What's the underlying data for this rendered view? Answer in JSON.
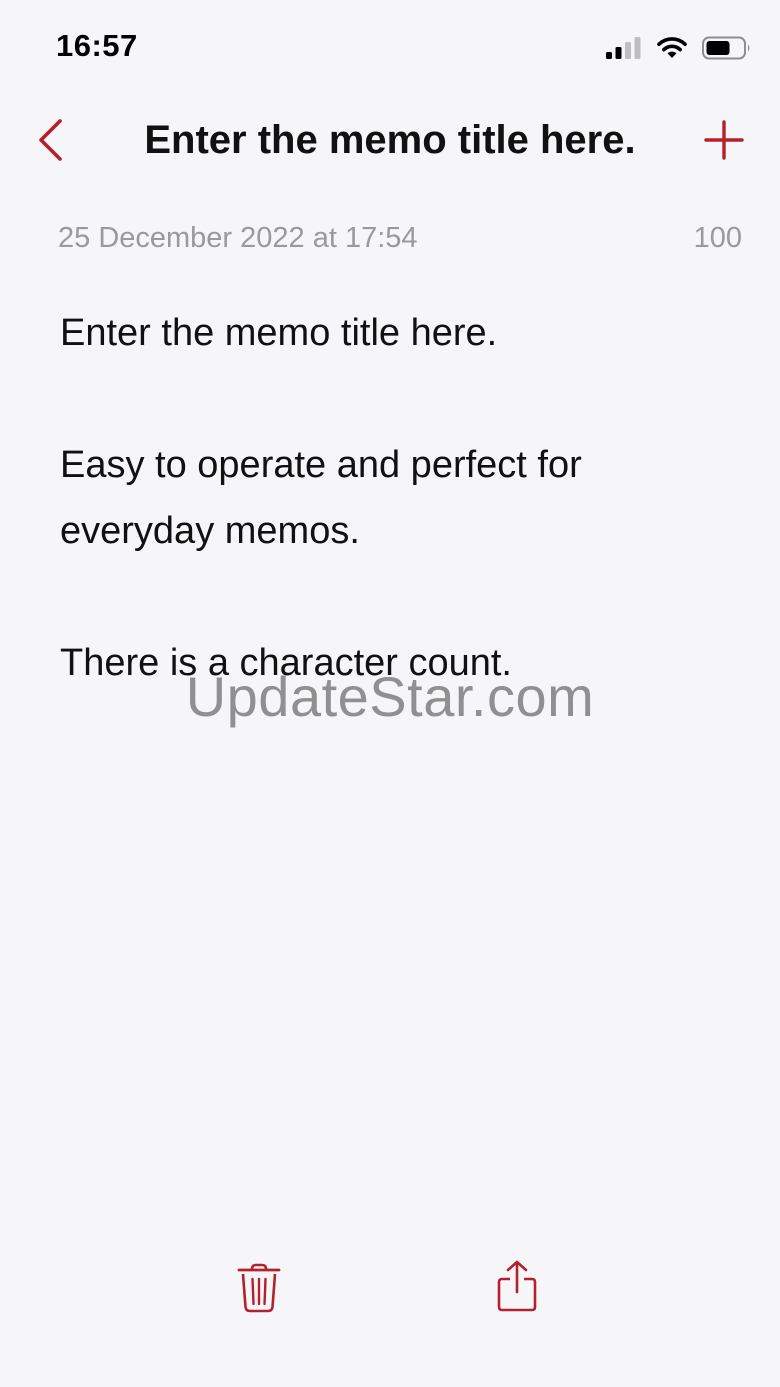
{
  "status_bar": {
    "time": "16:57"
  },
  "nav": {
    "title": "Enter the memo title here."
  },
  "meta": {
    "date": "25 December 2022 at 17:54",
    "character_count": "100"
  },
  "memo": {
    "lines": [
      "Enter the memo title here.",
      "",
      "Easy to operate and perfect for",
      "everyday memos.",
      "",
      "There is a character count."
    ]
  },
  "watermark": "UpdateStar.com",
  "icons": {
    "back": "chevron-left-icon",
    "add": "plus-icon",
    "trash": "trash-icon",
    "share": "share-icon",
    "signal": "cellular-signal-icon",
    "wifi": "wifi-icon",
    "battery": "battery-icon"
  },
  "colors": {
    "accent": "#b3202e",
    "background": "#f6f6f8",
    "meta_text": "#9a9a9e"
  }
}
